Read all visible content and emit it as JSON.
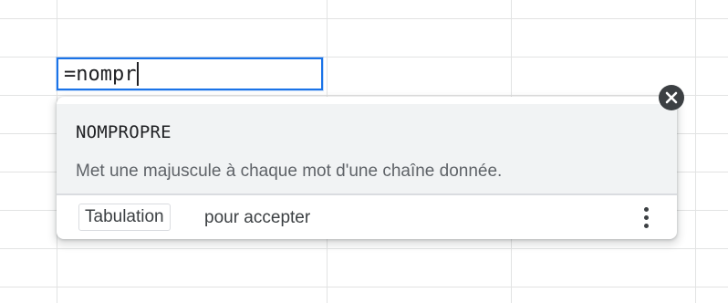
{
  "cell_editor": {
    "formula_text": "=nompr"
  },
  "autocomplete": {
    "function_name": "NOMPROPRE",
    "function_description": "Met une majuscule à chaque mot d'une chaîne donnée.",
    "accept_key": "Tabulation",
    "accept_hint": "pour accepter",
    "more_icon": "more-vert-icon",
    "close_icon": "close-icon"
  },
  "colors": {
    "accent": "#1a73e8",
    "grid": "#e2e3e3",
    "highlight": "#f1f3f4",
    "text_primary": "#202124",
    "text_secondary": "#5f6368"
  }
}
